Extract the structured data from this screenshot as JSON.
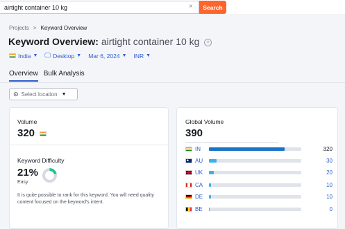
{
  "search": {
    "value": "airtight container 10 kg",
    "button_label": "Search",
    "clear_icon": "×"
  },
  "breadcrumb": {
    "items": [
      "Projects",
      "Keyword Overview"
    ],
    "separator": ">"
  },
  "title": {
    "prefix": "Keyword Overview:",
    "keyword": "airtight container 10 kg",
    "add_icon": "+"
  },
  "filters": {
    "country": "India",
    "device": "Desktop",
    "date": "Mar 6, 2024",
    "currency": "INR"
  },
  "tabs": [
    "Overview",
    "Bulk Analysis"
  ],
  "location": {
    "placeholder": "Select location"
  },
  "volume": {
    "label": "Volume",
    "value": "320"
  },
  "difficulty": {
    "label": "Keyword Difficulty",
    "value": "21%",
    "percent": 21,
    "level": "Easy",
    "description": "It is quite possible to rank for this keyword. You will need quality content focused on the keyword's intent."
  },
  "global_volume": {
    "label": "Global Volume",
    "value": "390",
    "countries": [
      {
        "code": "IN",
        "value": "320",
        "fraction": 0.82,
        "color": "#1a73c9"
      },
      {
        "code": "AU",
        "value": "30",
        "fraction": 0.08,
        "color": "#3ab0ef"
      },
      {
        "code": "UK",
        "value": "20",
        "fraction": 0.05,
        "color": "#3ab0ef"
      },
      {
        "code": "CA",
        "value": "10",
        "fraction": 0.02,
        "color": "#3ab0ef"
      },
      {
        "code": "DE",
        "value": "10",
        "fraction": 0.02,
        "color": "#3ab0ef"
      },
      {
        "code": "BE",
        "value": "0",
        "fraction": 0.0,
        "color": "#3ab0ef"
      }
    ]
  },
  "colors": {
    "accent": "#2c5ccd",
    "search_button": "#ff642d",
    "difficulty": "#21c38a"
  }
}
